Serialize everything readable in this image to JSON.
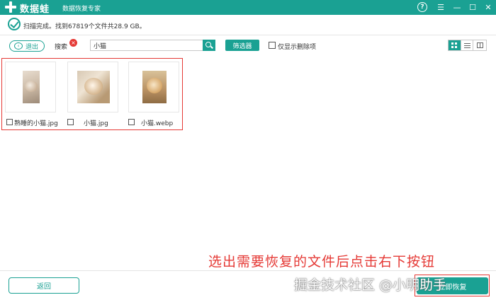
{
  "titlebar": {
    "logo_text": "数据蛙",
    "subtitle": "数据恢复专家",
    "help_label": "?",
    "menu_label": "☰",
    "minimize_label": "—",
    "maximize_label": "☐",
    "close_label": "✕"
  },
  "status": {
    "text": "扫描完成。找到67819个文件共28.9 GB。"
  },
  "toolbar": {
    "back_label": "退出",
    "search_label": "搜索",
    "clear_label": "×",
    "search_value": "小猫",
    "filter_label": "筛选器",
    "deleted_only_label": "仅显示删除项"
  },
  "files": [
    {
      "name": "熟睡的小猫.jpg"
    },
    {
      "name": "小猫.jpg"
    },
    {
      "name": "小猫.webp"
    }
  ],
  "bottom": {
    "return_label": "返回",
    "recover_label": "立即恢复"
  },
  "annotation": {
    "instruction": "选出需要恢复的文件后点击右下按钮",
    "watermark": "掘金技术社区 @小明助手"
  },
  "colors": {
    "accent": "#1aa193",
    "highlight": "#e53935"
  }
}
